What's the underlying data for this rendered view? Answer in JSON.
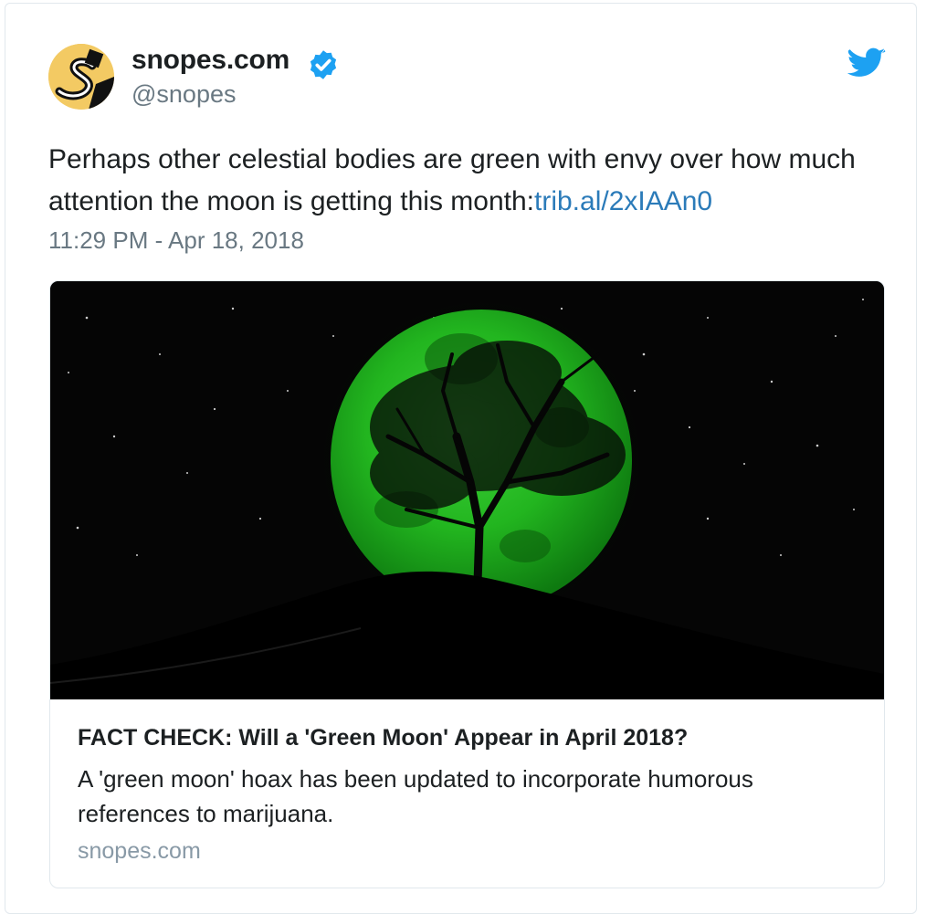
{
  "author": {
    "display_name": "snopes.com",
    "handle": "@snopes",
    "verified": true
  },
  "tweet": {
    "text": "Perhaps other celestial bodies are green with envy over how much attention the moon is getting this month:",
    "link_text": "trib.al/2xIAAn0",
    "timestamp": "11:29 PM - Apr 18, 2018"
  },
  "card": {
    "image_description_icon": "green-moon-tree-image",
    "title": "FACT CHECK: Will a 'Green Moon' Appear in April 2018?",
    "description": "A 'green moon' hoax has been updated to incorporate humorous references to marijuana.",
    "domain": "snopes.com"
  },
  "colors": {
    "link": "#2b7bb9",
    "secondary_text": "#697882",
    "twitter_blue": "#1da1f2",
    "avatar_yellow": "#f3ca63"
  }
}
